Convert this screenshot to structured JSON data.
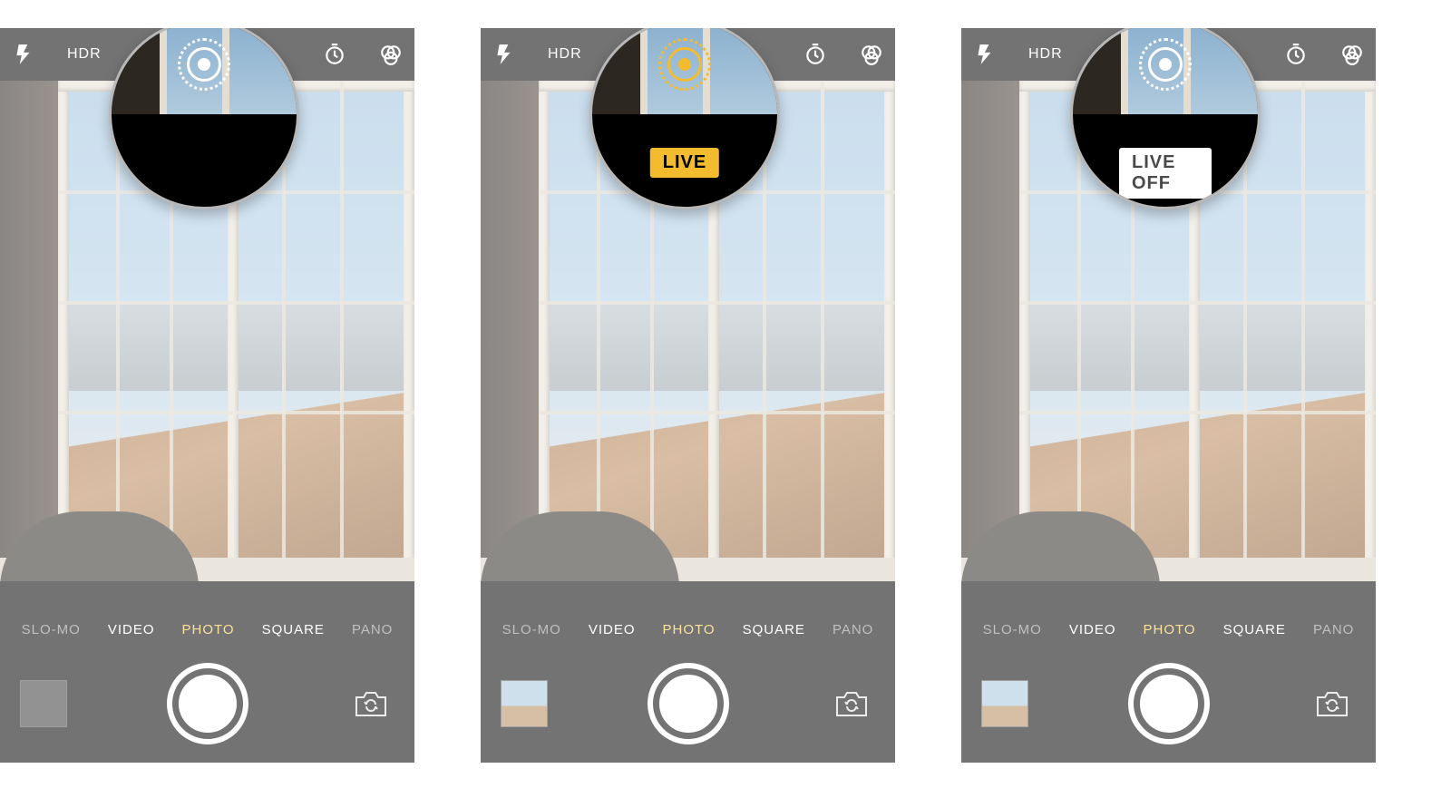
{
  "screens": [
    {
      "id": "default",
      "hdr_label": "HDR",
      "modes": [
        "SLO-MO",
        "VIDEO",
        "PHOTO",
        "SQUARE",
        "PANO"
      ],
      "selected_mode_index": 2,
      "thumb_filled": false,
      "callout": {
        "state": "neutral",
        "badge_text": null,
        "icon_color": "white"
      }
    },
    {
      "id": "live-on",
      "hdr_label": "HDR",
      "modes": [
        "SLO-MO",
        "VIDEO",
        "PHOTO",
        "SQUARE",
        "PANO"
      ],
      "selected_mode_index": 2,
      "thumb_filled": true,
      "callout": {
        "state": "on",
        "badge_text": "LIVE",
        "icon_color": "yellow"
      }
    },
    {
      "id": "live-off",
      "hdr_label": "HDR",
      "modes": [
        "SLO-MO",
        "VIDEO",
        "PHOTO",
        "SQUARE",
        "PANO"
      ],
      "selected_mode_index": 2,
      "thumb_filled": true,
      "callout": {
        "state": "off",
        "badge_text": "LIVE OFF",
        "icon_color": "white"
      }
    }
  ],
  "colors": {
    "accent_yellow": "#f3bb2e"
  }
}
